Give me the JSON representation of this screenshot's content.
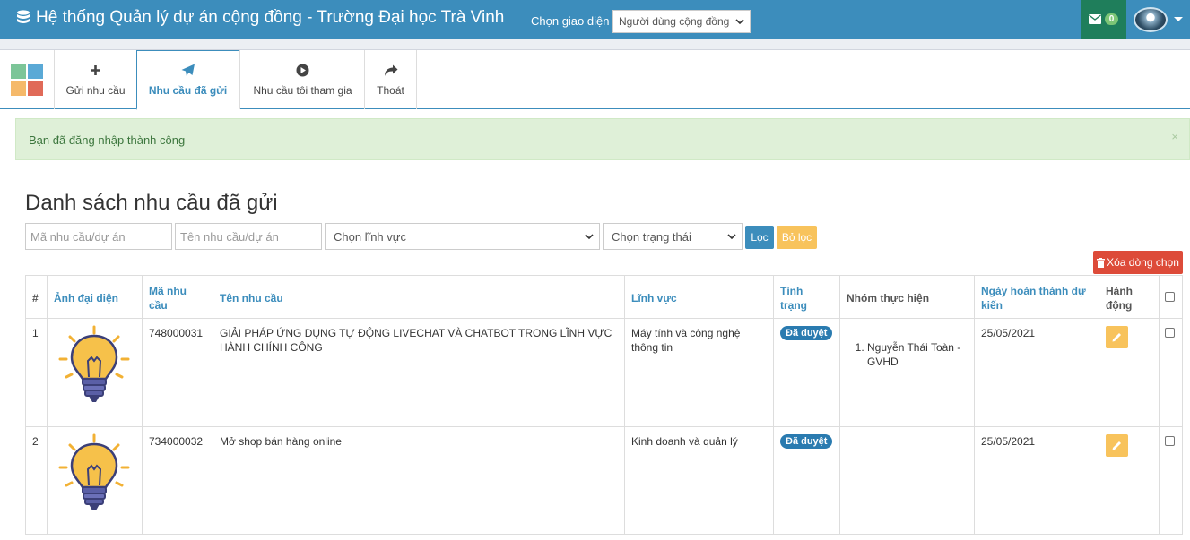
{
  "header": {
    "title": "Hệ thống Quản lý dự án cộng đồng - Trường Đại học Trà Vinh",
    "theme_label": "Chọn giao diện",
    "theme_value": "Người dùng cộng đồng",
    "message_count": "0"
  },
  "toolbar": {
    "tabs": [
      {
        "label": "Gửi nhu cầu",
        "icon": "plus-icon"
      },
      {
        "label": "Nhu cầu đã gửi",
        "icon": "paper-plane-icon",
        "active": true
      },
      {
        "label": "Nhu cầu tôi tham gia",
        "icon": "play-circle-icon"
      },
      {
        "label": "Thoát",
        "icon": "share-icon"
      }
    ]
  },
  "alert": {
    "message": "Bạn đã đăng nhập thành công",
    "close": "×"
  },
  "page_title": "Danh sách nhu cầu đã gửi",
  "filters": {
    "code_placeholder": "Mã nhu cầu/dự án",
    "name_placeholder": "Tên nhu cầu/dự án",
    "field_select": "Chọn lĩnh vực",
    "status_select": "Chọn trạng thái",
    "filter_button": "Lọc",
    "clear_button": "Bỏ lọc"
  },
  "delete_selected": "Xóa dòng chọn",
  "table": {
    "headers": {
      "index": "#",
      "avatar": "Ảnh đại diện",
      "code": "Mã nhu cầu",
      "name": "Tên nhu cầu",
      "field": "Lĩnh vực",
      "status": "Tình trạng",
      "team": "Nhóm thực hiện",
      "due_date": "Ngày hoàn thành dự kiến",
      "action": "Hành động"
    },
    "rows": [
      {
        "index": "1",
        "code": "748000031",
        "name": "GIẢI PHÁP ỨNG DỤNG TỰ ĐỘNG LIVECHAT VÀ CHATBOT TRONG LĨNH VỰC HÀNH CHÍNH CÔNG",
        "field": "Máy tính và công nghệ thông tin",
        "status": "Đã duyệt",
        "team": [
          "Nguyễn Thái Toàn - GVHD"
        ],
        "due_date": "25/05/2021"
      },
      {
        "index": "2",
        "code": "734000032",
        "name": "Mở shop bán hàng online",
        "field": "Kinh doanh và quản lý",
        "status": "Đã duyệt",
        "team": [],
        "due_date": "25/05/2021"
      }
    ]
  },
  "colors": {
    "primary": "#3c8dbc",
    "danger": "#dd4b39",
    "warning": "#f8c35c",
    "success_bg": "#dff0d8"
  }
}
